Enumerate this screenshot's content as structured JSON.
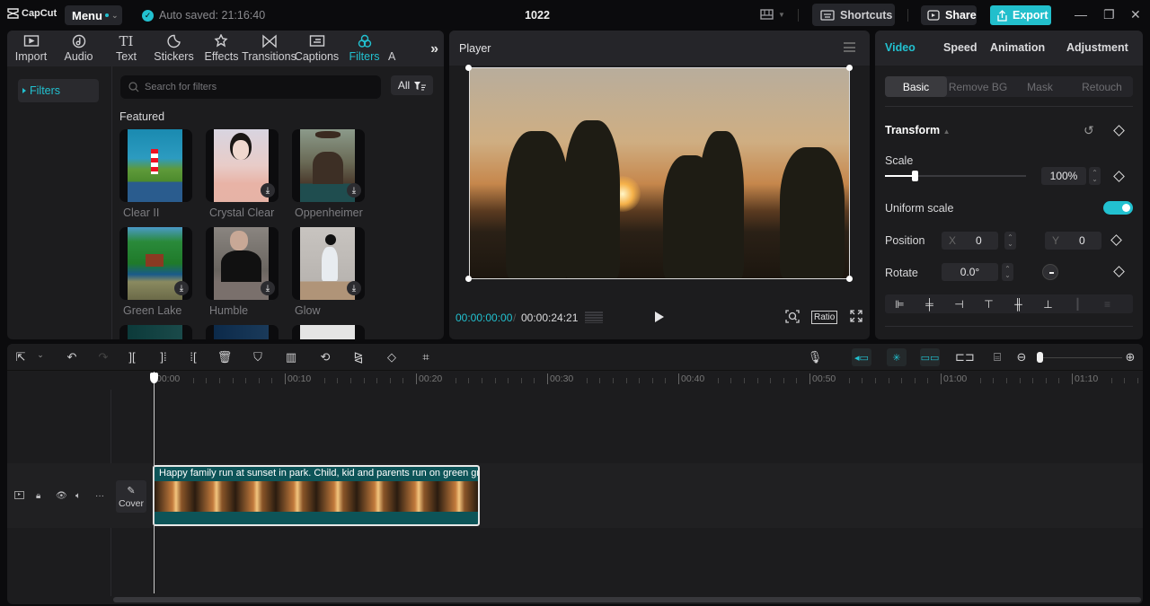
{
  "app": {
    "logo": "CapCut",
    "menu_label": "Menu",
    "autosave": "Auto saved: 21:16:40",
    "project_title": "1022",
    "shortcuts_label": "Shortcuts",
    "share_label": "Share",
    "export_label": "Export"
  },
  "media_tabs": [
    {
      "label": "Import",
      "icon": "import-icon"
    },
    {
      "label": "Audio",
      "icon": "audio-icon"
    },
    {
      "label": "Text",
      "icon": "text-icon"
    },
    {
      "label": "Stickers",
      "icon": "stickers-icon"
    },
    {
      "label": "Effects",
      "icon": "effects-icon"
    },
    {
      "label": "Transitions",
      "icon": "transitions-icon"
    },
    {
      "label": "Captions",
      "icon": "captions-icon"
    },
    {
      "label": "Filters",
      "icon": "filters-icon",
      "active": true
    },
    {
      "label": "A",
      "icon": ""
    }
  ],
  "filters_panel": {
    "sidebar_item": "Filters",
    "search_placeholder": "Search for filters",
    "filter_all": "All",
    "section_title": "Featured",
    "items": [
      {
        "label": "Clear II",
        "downloaded": true
      },
      {
        "label": "Crystal Clear",
        "downloaded": false
      },
      {
        "label": "Oppenheimer",
        "downloaded": false
      },
      {
        "label": "Green Lake",
        "downloaded": false
      },
      {
        "label": "Humble",
        "downloaded": false
      },
      {
        "label": "Glow",
        "downloaded": false
      }
    ]
  },
  "player": {
    "title": "Player",
    "current_time": "00:00:00:00",
    "separator": "/",
    "total_time": "00:00:24:21",
    "ratio_label": "Ratio"
  },
  "inspector": {
    "tabs": [
      "Video",
      "Speed",
      "Animation",
      "Adjustment"
    ],
    "active_tab": "Video",
    "subtabs": [
      "Basic",
      "Remove BG",
      "Mask",
      "Retouch"
    ],
    "active_subtab": "Basic",
    "section": "Transform",
    "scale_label": "Scale",
    "scale_value": "100%",
    "scale_slider_fraction": 0.21,
    "uniform_scale_label": "Uniform scale",
    "uniform_scale_on": true,
    "position_label": "Position",
    "pos_x_label": "X",
    "pos_x": "0",
    "pos_y_label": "Y",
    "pos_y": "0",
    "rotate_label": "Rotate",
    "rotate_value": "0.0°"
  },
  "timeline": {
    "ruler": [
      "00:00",
      "00:10",
      "00:20",
      "00:30",
      "00:40",
      "00:50",
      "01:00",
      "01:10"
    ],
    "cover_label": "Cover",
    "clip_title": "Happy family run at sunset in park. Child, kid and parents run on green grass"
  }
}
